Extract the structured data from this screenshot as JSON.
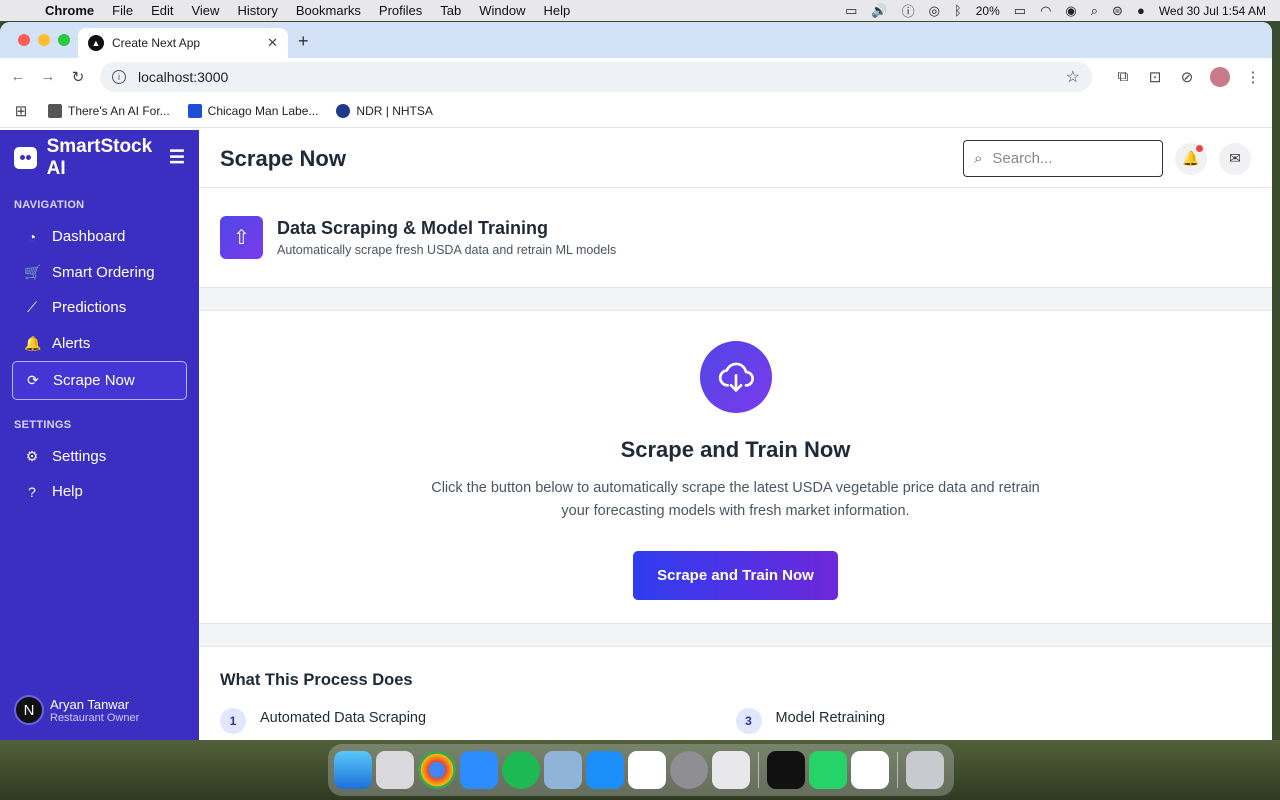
{
  "menubar": {
    "apple_icon": "apple-icon",
    "app_name": "Chrome",
    "items": [
      "File",
      "Edit",
      "View",
      "History",
      "Bookmarks",
      "Profiles",
      "Tab",
      "Window",
      "Help"
    ],
    "battery": "20%",
    "datetime": "Wed 30 Jul  1:54 AM"
  },
  "browser": {
    "tab_title": "Create Next App",
    "url": "localhost:3000",
    "bookmarks": [
      "There's An AI For...",
      "Chicago Man Labe...",
      "NDR | NHTSA"
    ]
  },
  "sidebar": {
    "brand": "SmartStock AI",
    "nav_heading": "NAVIGATION",
    "nav_items": [
      {
        "label": "Dashboard",
        "icon": "dashboard-icon"
      },
      {
        "label": "Smart Ordering",
        "icon": "cart-icon"
      },
      {
        "label": "Predictions",
        "icon": "chart-line-icon"
      },
      {
        "label": "Alerts",
        "icon": "bell-icon"
      },
      {
        "label": "Scrape Now",
        "icon": "refresh-icon"
      }
    ],
    "settings_heading": "SETTINGS",
    "settings_items": [
      {
        "label": "Settings",
        "icon": "gear-icon"
      },
      {
        "label": "Help",
        "icon": "help-icon"
      }
    ],
    "user": {
      "initial": "N",
      "name": "Aryan Tanwar",
      "role": "Restaurant Owner"
    }
  },
  "header": {
    "page_title": "Scrape Now",
    "search_placeholder": "Search..."
  },
  "intro_card": {
    "title": "Data Scraping & Model Training",
    "subtitle": "Automatically scrape fresh USDA data and retrain ML models"
  },
  "action_card": {
    "title": "Scrape and Train Now",
    "description": "Click the button below to automatically scrape the latest USDA vegetable price data and retrain your forecasting models with fresh market information.",
    "button_label": "Scrape and Train Now"
  },
  "process": {
    "title": "What This Process Does",
    "steps": [
      {
        "num": "1",
        "title": "Automated Data Scraping"
      },
      {
        "num": "3",
        "title": "Model Retraining"
      }
    ]
  },
  "colors": {
    "sidebar": "#3b2fc2",
    "accent_start": "#2f3df0",
    "accent_end": "#6d28d9"
  }
}
